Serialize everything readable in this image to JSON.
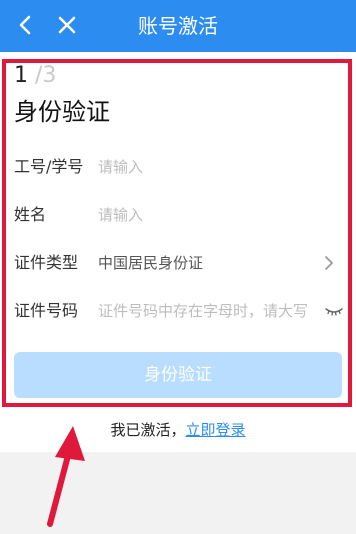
{
  "header": {
    "title": "账号激活",
    "back_icon": "back-arrow-icon",
    "close_icon": "close-icon"
  },
  "step": {
    "current": "1",
    "total": "/3",
    "title": "身份验证"
  },
  "form": {
    "rows": [
      {
        "label": "工号/学号",
        "placeholder": "请输入"
      },
      {
        "label": "姓名",
        "placeholder": "请输入"
      },
      {
        "label": "证件类型",
        "value": "中国居民身份证",
        "icon": "chevron-right-icon"
      },
      {
        "label": "证件号码",
        "placeholder": "证件号码中存在字母时，请大写",
        "icon": "eye-closed-icon"
      }
    ]
  },
  "button": {
    "label": "身份验证"
  },
  "login": {
    "text": "我已激活，",
    "link": "立即登录"
  },
  "colors": {
    "primary": "#2d8cf0",
    "button_disabled": "#b9ddff",
    "highlight_red": "#e0183b"
  }
}
